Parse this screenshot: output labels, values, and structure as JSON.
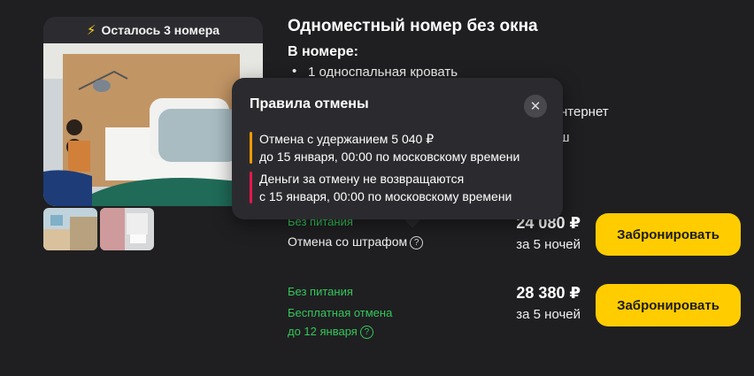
{
  "photo": {
    "badge": "Осталось 3 номера"
  },
  "room": {
    "title": "Одноместный номер без окна",
    "in_room_label": "В номере:",
    "amenities": [
      "1 односпальная кровать",
      "нтернет",
      "уш"
    ]
  },
  "tooltip": {
    "title": "Правила отмены",
    "close_glyph": "✕",
    "rules": [
      {
        "line1": "Отмена с удержанием 5 040 ₽",
        "line2": "до 15 января, 00:00 по московскому времени",
        "color": "#f29900"
      },
      {
        "line1": "Деньги за отмену не возвращаются",
        "line2": "с 15 января, 00:00 по московскому времени",
        "color": "#e8174c"
      }
    ]
  },
  "offers": [
    {
      "meal": "Без питания",
      "cancel": "Отмена со штрафом",
      "price": "24 080 ₽",
      "nights": "за 5 ночей",
      "button": "Забронировать"
    },
    {
      "meal": "Без питания",
      "cancel_line1": "Бесплатная отмена",
      "cancel_line2": "до 12 января",
      "price": "28 380 ₽",
      "nights": "за 5 ночей",
      "button": "Забронировать"
    }
  ],
  "colors": {
    "background": "#1f1f22",
    "accent": "#ffcc00",
    "green": "#34c759",
    "warning": "#f29900",
    "danger": "#e8174c"
  },
  "icons": {
    "badge": "lightning-icon",
    "help": "question-circle-icon",
    "close": "close-icon"
  }
}
